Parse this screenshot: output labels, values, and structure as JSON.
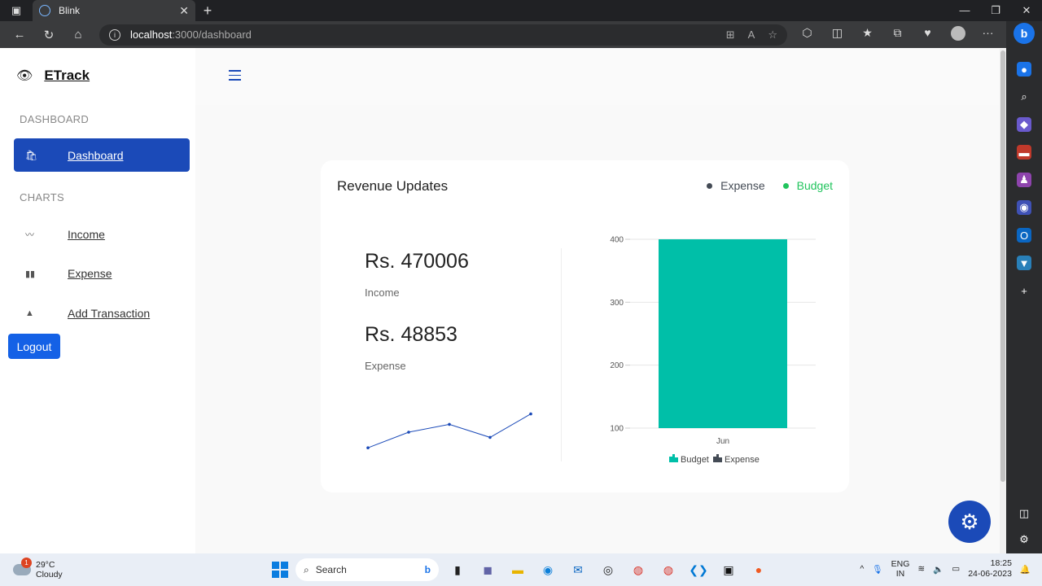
{
  "browser": {
    "tab_title": "Blink",
    "url_host": "localhost",
    "url_path": ":3000/dashboard"
  },
  "app": {
    "brand": "ETrack",
    "sections": {
      "dashboard": "DASHBOARD",
      "charts": "CHARTS"
    },
    "nav": {
      "dashboard": "Dashboard",
      "income": "Income",
      "expense": "Expense",
      "add_transaction": "Add Transaction"
    },
    "logout": "Logout"
  },
  "card": {
    "title": "Revenue Updates",
    "legend": [
      {
        "label": "Expense",
        "color": "#444b55"
      },
      {
        "label": "Budget",
        "color": "#21c45d"
      }
    ],
    "income_value": "Rs. 470006",
    "income_label": "Income",
    "expense_value": "Rs. 48853",
    "expense_label": "Expense"
  },
  "chart_data": [
    {
      "type": "line",
      "x": [
        1,
        2,
        3,
        4,
        5
      ],
      "values": [
        2,
        5,
        6.5,
        4,
        8.5
      ],
      "color": "#1b4ab8"
    },
    {
      "type": "bar",
      "categories": [
        "Jun"
      ],
      "series": [
        {
          "name": "Budget",
          "values": [
            400
          ],
          "color": "#00bfa8"
        },
        {
          "name": "Expense",
          "values": [
            0
          ],
          "color": "#444b55"
        }
      ],
      "yticks": [
        "100",
        "200",
        "300",
        "400"
      ],
      "ylim": [
        100,
        400
      ]
    }
  ],
  "taskbar": {
    "weather_temp": "29°C",
    "weather_desc": "Cloudy",
    "weather_badge": "1",
    "search": "Search",
    "lang1": "ENG",
    "lang2": "IN",
    "time": "18:25",
    "date": "24-06-2023"
  }
}
